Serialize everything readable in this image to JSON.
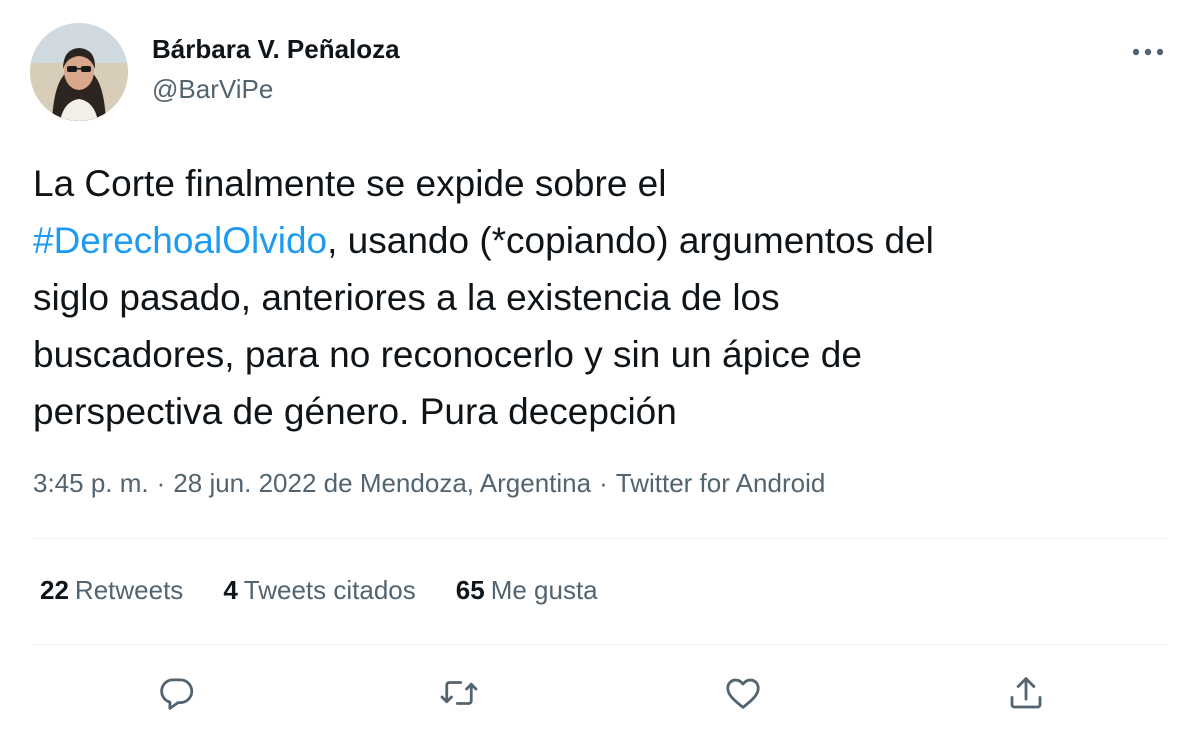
{
  "author": {
    "name": "Bárbara V. Peñaloza",
    "handle": "@BarViPe"
  },
  "tweet": {
    "lines": [
      [
        {
          "text": "La Corte finalmente se expide sobre el",
          "hashtag": false
        }
      ],
      [
        {
          "text": "#DerechoalOlvido",
          "hashtag": true
        },
        {
          "text": ", usando (*copiando) argumentos del",
          "hashtag": false
        }
      ],
      [
        {
          "text": "siglo pasado, anteriores a la existencia de los",
          "hashtag": false
        }
      ],
      [
        {
          "text": "buscadores, para no reconocerlo y sin un ápice de",
          "hashtag": false
        }
      ],
      [
        {
          "text": "perspectiva de género. Pura decepción",
          "hashtag": false
        }
      ]
    ]
  },
  "meta": {
    "time": "3:45 p. m.",
    "date": "28 jun. 2022",
    "location": "de Mendoza, Argentina",
    "source": "Twitter for Android",
    "separator": "·"
  },
  "stats": {
    "retweets_count": "22",
    "retweets_label": "Retweets",
    "quotes_count": "4",
    "quotes_label": "Tweets citados",
    "likes_count": "65",
    "likes_label": "Me gusta"
  },
  "actions": {
    "reply_icon": "reply-icon",
    "retweet_icon": "retweet-icon",
    "like_icon": "heart-icon",
    "share_icon": "share-icon"
  },
  "colors": {
    "text": "#0f1419",
    "secondary": "#536471",
    "hashtag": "#1d9bf0",
    "divider": "#eff3f4"
  }
}
